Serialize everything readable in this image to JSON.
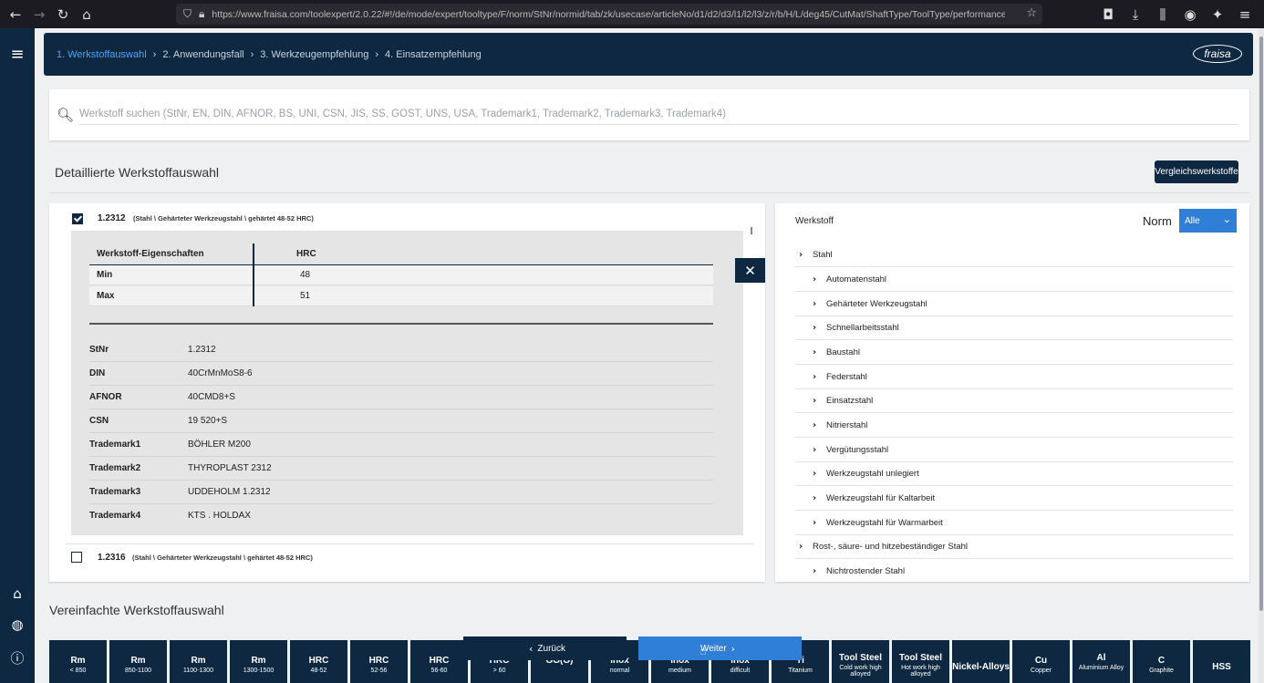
{
  "browser": {
    "url": "https://www.fraisa.com/toolexpert/2.0.22/#!/de/mode/expert/tooltype/F/norm/StNr/normid/tab/zk/usecase/articleNo/d1/d2/d3/l1/l2/l3/z/r/b/H/L/deg45/CutMat/ShaftType/ToolType/performance_class"
  },
  "header": {
    "breadcrumbs": [
      "1. Werkstoffauswahl",
      "2. Anwendungsfall",
      "3. Werkzeugempfehlung",
      "4. Einsatzempfehlung"
    ],
    "logo_text": "fraisa"
  },
  "search": {
    "placeholder": "Werkstoff suchen (StNr, EN, DIN, AFNOR, BS, UNI, CSN, JIS, SS, GOST, UNS, USA, Trademark1, Trademark2, Trademark3, Trademark4)"
  },
  "detail": {
    "title": "Detaillierte Werkstoffauswahl",
    "compare_button": "Vergleichswerkstoffe"
  },
  "materials": [
    {
      "number": "1.2312",
      "path": "(Stahl \\ Gehärteter Werkzeugstahl \\ gehärtet 48-52 HRC)",
      "checked": true
    },
    {
      "number": "1.2316",
      "path": "(Stahl \\ Gehärteter Werkzeugstahl \\ gehärtet 48-52 HRC)",
      "checked": false
    }
  ],
  "properties": {
    "header_label": "Werkstoff-Eigenschaften",
    "header_unit": "HRC",
    "rows": [
      {
        "label": "Min",
        "value": "48"
      },
      {
        "label": "Max",
        "value": "51"
      }
    ]
  },
  "attributes": [
    {
      "label": "StNr",
      "value": "1.2312"
    },
    {
      "label": "DIN",
      "value": "40CrMnMoS8-6"
    },
    {
      "label": "AFNOR",
      "value": "40CMD8+S"
    },
    {
      "label": "CSN",
      "value": "19 520+S"
    },
    {
      "label": "Trademark1",
      "value": "BÖHLER M200"
    },
    {
      "label": "Trademark2",
      "value": "THYROPLAST 2312"
    },
    {
      "label": "Trademark3",
      "value": "UDDEHOLM 1.2312"
    },
    {
      "label": "Trademark4",
      "value": "KTS . HOLDAX"
    }
  ],
  "tree": {
    "title": "Werkstoff",
    "norm_label": "Norm",
    "norm_value": "Alle",
    "items": [
      {
        "label": "Stahl",
        "level": 0
      },
      {
        "label": "Automatenstahl",
        "level": 1
      },
      {
        "label": "Gehärteter Werkzeugstahl",
        "level": 1
      },
      {
        "label": "Schnellarbeitsstahl",
        "level": 1
      },
      {
        "label": "Baustahl",
        "level": 1
      },
      {
        "label": "Federstahl",
        "level": 1
      },
      {
        "label": "Einsatzstahl",
        "level": 1
      },
      {
        "label": "Nitrierstahl",
        "level": 1
      },
      {
        "label": "Vergütungsstahl",
        "level": 1
      },
      {
        "label": "Werkzeugstahl unlegiert",
        "level": 1
      },
      {
        "label": "Werkzeugstahl für Kaltarbeit",
        "level": 1
      },
      {
        "label": "Werkzeugstahl für Warmarbeit",
        "level": 1
      },
      {
        "label": "Rost-, säure- und hitzebeständiger Stahl",
        "level": 0
      },
      {
        "label": "Nichtrostender Stahl",
        "level": 1
      }
    ]
  },
  "simple": {
    "title": "Vereinfachte Werkstoffauswahl",
    "tiles": [
      {
        "main": "Rm",
        "sub": "< 850"
      },
      {
        "main": "Rm",
        "sub": "850-1100"
      },
      {
        "main": "Rm",
        "sub": "1100-1300"
      },
      {
        "main": "Rm",
        "sub": "1300-1500"
      },
      {
        "main": "HRC",
        "sub": "48-52"
      },
      {
        "main": "HRC",
        "sub": "52-56"
      },
      {
        "main": "HRC",
        "sub": "56-60"
      },
      {
        "main": "HRC",
        "sub": "> 60"
      },
      {
        "main": "GG(G)",
        "sub": ""
      },
      {
        "main": "Inox",
        "sub": "normal"
      },
      {
        "main": "Inox",
        "sub": "medium"
      },
      {
        "main": "Inox",
        "sub": "difficult"
      },
      {
        "main": "Ti",
        "sub": "Titanium"
      },
      {
        "main": "Tool Steel",
        "sub": "Cold work high alloyed"
      },
      {
        "main": "Tool Steel",
        "sub": "Hot work high alloyed"
      },
      {
        "main": "Nickel-Alloys",
        "sub": ""
      },
      {
        "main": "Cu",
        "sub": "Copper"
      },
      {
        "main": "Al",
        "sub": "Aluminium Alloy"
      },
      {
        "main": "C",
        "sub": "Graphite"
      },
      {
        "main": "HSS",
        "sub": ""
      }
    ],
    "back_label": "Zurück",
    "next_label": "Weiter"
  }
}
